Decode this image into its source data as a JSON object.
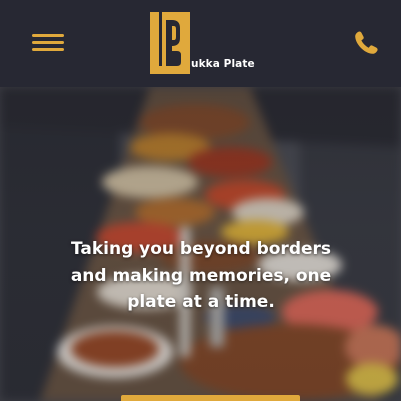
{
  "header": {
    "brand_name": "ukka Plate",
    "logo_initial": "B",
    "menu_icon": "hamburger-menu-icon",
    "phone_icon": "phone-icon"
  },
  "hero": {
    "tagline": "Taking you beyond borders and making memories, one plate at a time."
  },
  "colors": {
    "header_bg": "#272833",
    "accent": "#e0a93c",
    "text": "#ffffff"
  }
}
